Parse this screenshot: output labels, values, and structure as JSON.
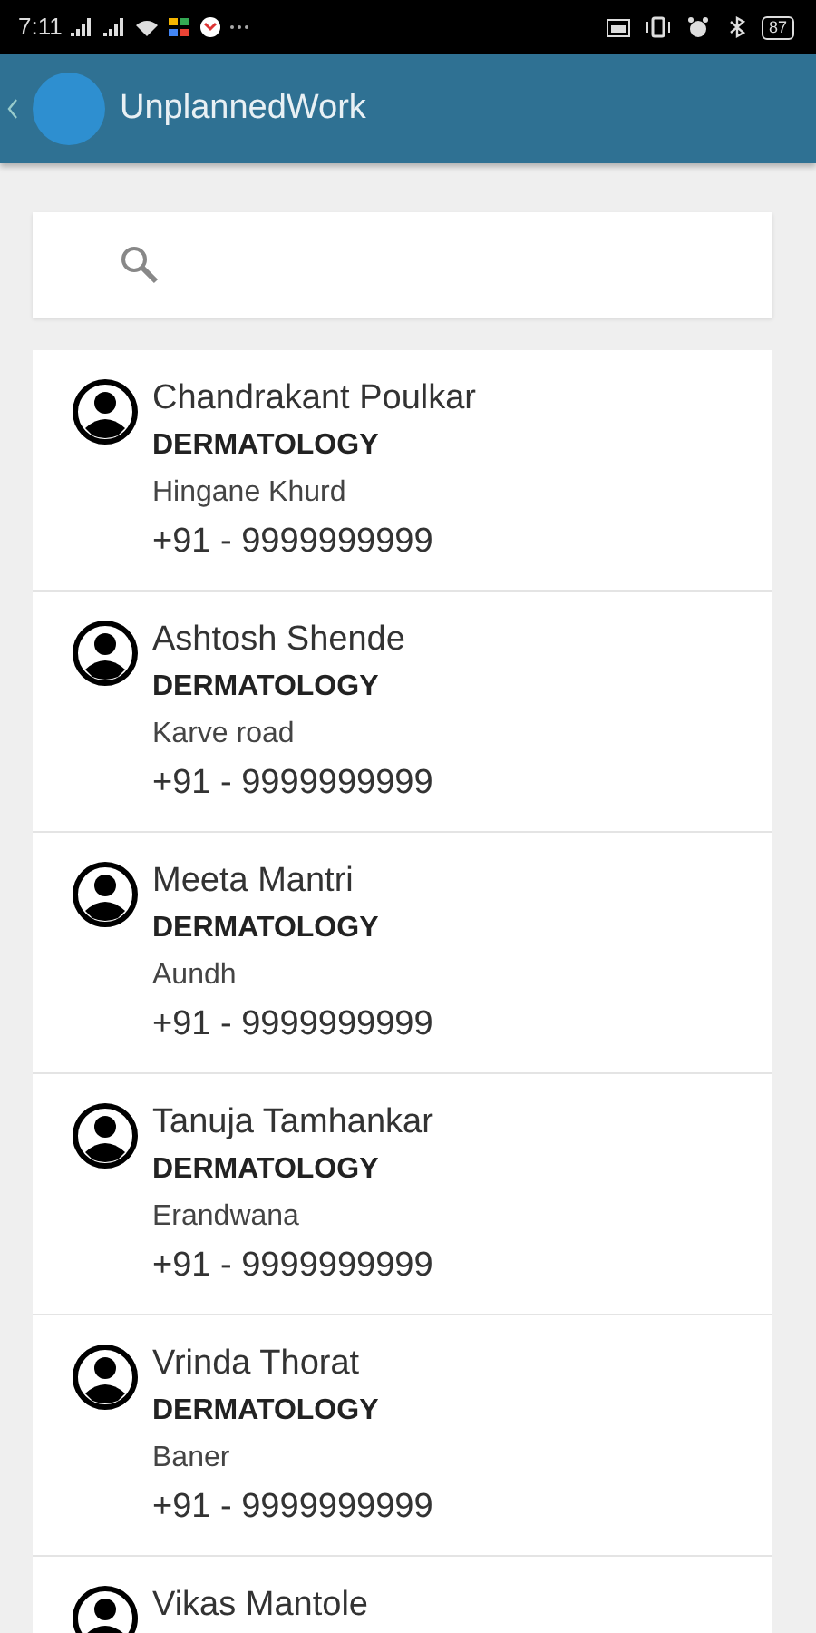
{
  "status_bar": {
    "time": "7:11",
    "battery": "87"
  },
  "header": {
    "title": "UnplannedWork"
  },
  "contacts": [
    {
      "name": "Chandrakant Poulkar",
      "department": "DERMATOLOGY",
      "location": "Hingane Khurd",
      "phone": "+91 - 9999999999"
    },
    {
      "name": "Ashtosh Shende",
      "department": "DERMATOLOGY",
      "location": "Karve road",
      "phone": "+91 - 9999999999"
    },
    {
      "name": "Meeta Mantri",
      "department": "DERMATOLOGY",
      "location": "Aundh",
      "phone": "+91 - 9999999999"
    },
    {
      "name": "Tanuja Tamhankar",
      "department": "DERMATOLOGY",
      "location": "Erandwana",
      "phone": "+91 - 9999999999"
    },
    {
      "name": "Vrinda Thorat",
      "department": "DERMATOLOGY",
      "location": "Baner",
      "phone": "+91 - 9999999999"
    },
    {
      "name": "Vikas Mantole"
    }
  ]
}
